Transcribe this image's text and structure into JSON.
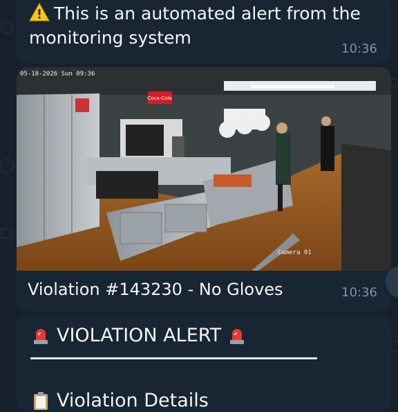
{
  "messages": {
    "alert_intro": {
      "icon": "warning-icon",
      "text": "This is an automated alert from the monitoring system",
      "time": "10:36"
    },
    "camera_snapshot": {
      "overlay_timestamp": "05-18-2026 Sun 09:36",
      "overlay_camera": "Camera 01",
      "sign_text": "Coca-Cola",
      "caption": "Violation #143230 - No Gloves",
      "time": "10:36"
    },
    "violation_alert": {
      "icon": "siren-icon",
      "title": "VIOLATION ALERT",
      "details_icon": "clipboard-icon",
      "details_label": "Violation Details"
    }
  },
  "colors": {
    "chat_background": "#17212b",
    "bubble_background": "#182533",
    "timestamp": "#7f91a4",
    "warning": "#f5c518",
    "siren_red": "#e53935"
  }
}
